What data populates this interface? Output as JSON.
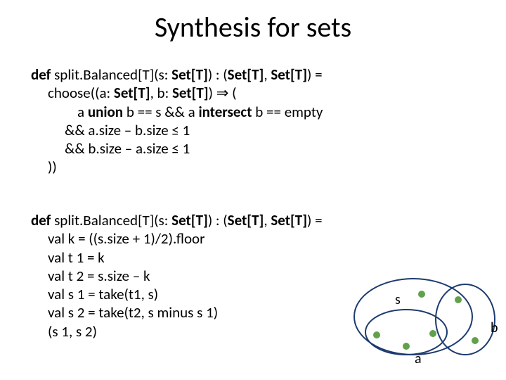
{
  "title": "Synthesis for sets",
  "spec": {
    "sig_pre": "def",
    "sig_mid1": " split.Balanced[T](s: ",
    "sig_set1": "Set[T]",
    "sig_mid2": ") : (",
    "sig_set2": "Set[T]",
    "sig_mid3": ", ",
    "sig_set3": "Set[T]",
    "sig_mid4": ") =",
    "l2a": "choose((a: ",
    "l2b": "Set[T]",
    "l2c": ", b: ",
    "l2d": "Set[T]",
    "l2e": ") ⇒ (",
    "l3a": "a ",
    "l3b": "union",
    "l3c": " b == s && a ",
    "l3d": "intersect",
    "l3e": " b == empty",
    "l4": "&& a.size – b.size ≤ 1",
    "l5": "&& b.size – a.size ≤ 1",
    "l6": "))"
  },
  "impl": {
    "sig_pre": "def",
    "sig_mid1": " split.Balanced[T](s: ",
    "sig_set1": "Set[T]",
    "sig_mid2": ") : (",
    "sig_set2": "Set[T]",
    "sig_mid3": ", ",
    "sig_set3": "Set[T]",
    "sig_mid4": ") =",
    "l2": "val k = ((s.size + 1)/2).floor",
    "l3": "val t 1 = k",
    "l4": "val t 2 = s.size – k",
    "l5": "val s 1 = take(t1, s)",
    "l6": "val s 2 = take(t2, s minus s 1)",
    "l7": "(s 1, s 2)"
  },
  "diagram": {
    "label_s": "s",
    "label_a": "a",
    "label_b": "b"
  }
}
